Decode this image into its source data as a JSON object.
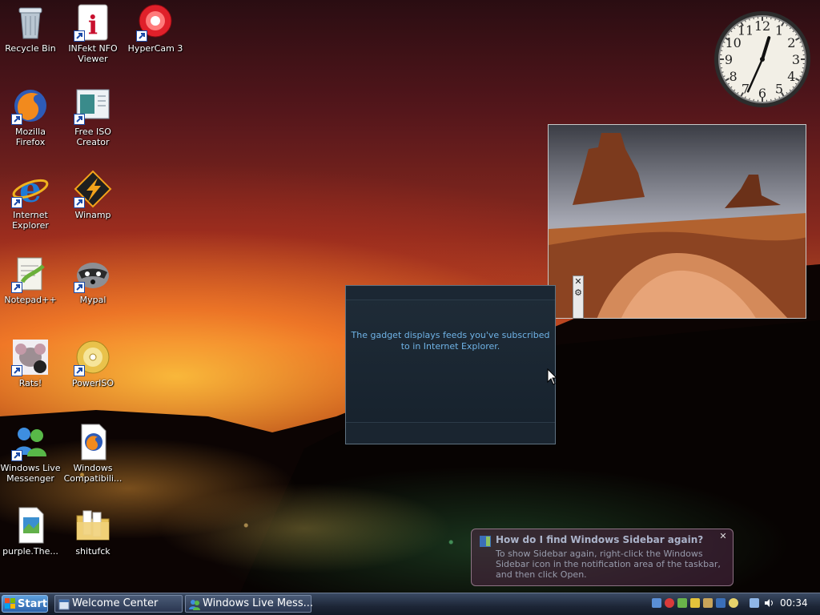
{
  "desktop": {
    "icons": [
      {
        "label": "Recycle Bin",
        "name": "recycle-bin"
      },
      {
        "label": "INFekt NFO Viewer",
        "name": "infekt-nfo-viewer"
      },
      {
        "label": "HyperCam 3",
        "name": "hypercam-3"
      },
      {
        "label": "Mozilla Firefox",
        "name": "mozilla-firefox"
      },
      {
        "label": "Free ISO Creator",
        "name": "free-iso-creator"
      },
      {
        "label": "Internet Explorer",
        "name": "internet-explorer"
      },
      {
        "label": "Winamp",
        "name": "winamp"
      },
      {
        "label": "Notepad++",
        "name": "notepad-plus-plus"
      },
      {
        "label": "Mypal",
        "name": "mypal"
      },
      {
        "label": "Rats!",
        "name": "rats"
      },
      {
        "label": "PowerISO",
        "name": "poweriso"
      },
      {
        "label": "Windows Live Messenger",
        "name": "windows-live-messenger"
      },
      {
        "label": "Windows Compatibili...",
        "name": "windows-compatibility"
      },
      {
        "label": "purple.The...",
        "name": "purple-the"
      },
      {
        "label": "shitufck",
        "name": "shitufck"
      }
    ]
  },
  "clock": {
    "numbers": [
      "12",
      "1",
      "2",
      "3",
      "4",
      "5",
      "6",
      "7",
      "8",
      "9",
      "10",
      "11"
    ],
    "hour": 12,
    "minute": 34
  },
  "feed_gadget": {
    "message": "The gadget displays feeds you've subscribed to in Internet Explorer."
  },
  "slideshow_controls": {
    "close_glyph": "✕",
    "options_glyph": "⚙"
  },
  "notification": {
    "title": "How do I find Windows Sidebar again?",
    "text": "To show Sidebar again, right-click the Windows Sidebar icon in the notification area of the taskbar, and then click Open.",
    "close_glyph": "✕"
  },
  "taskbar": {
    "start_label": "Start",
    "tasks": [
      {
        "label": "Welcome Center"
      },
      {
        "label": "Windows Live Mess..."
      }
    ],
    "time": "00:34"
  },
  "colors": {
    "feed_text": "#6fb3e6",
    "taskbar_bg": "#1d2637",
    "start_button": "#2b62a9"
  }
}
